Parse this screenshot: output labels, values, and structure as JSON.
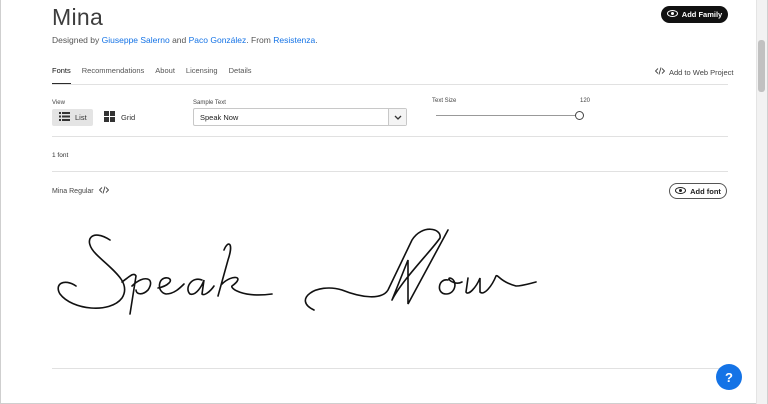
{
  "font": {
    "title": "Mina",
    "designed_prefix": "Designed by",
    "designer1": "Giuseppe Salerno",
    "and": "and",
    "designer2": "Paco González",
    "from": ". From",
    "foundry": "Resistenza",
    "period": "."
  },
  "header": {
    "add_family_label": "Add Family",
    "add_web_label": "Add to Web Project"
  },
  "tabs": [
    {
      "label": "Fonts",
      "active": true
    },
    {
      "label": "Recommendations",
      "active": false
    },
    {
      "label": "About",
      "active": false
    },
    {
      "label": "Licensing",
      "active": false
    },
    {
      "label": "Details",
      "active": false
    }
  ],
  "controls": {
    "view_label": "View",
    "list_label": "List",
    "grid_label": "Grid",
    "sample_label": "Sample Text",
    "sample_value": "Speak Now",
    "size_label": "Text Size",
    "size_value": "120"
  },
  "results": {
    "count": "1 font"
  },
  "style_card": {
    "name": "Mina Regular",
    "add_font_label": "Add font",
    "preview_text": "Speak Now"
  },
  "help": {
    "label": "?"
  },
  "colors": {
    "accent": "#1473e6",
    "dark": "#111111"
  },
  "icons": [
    "eye-icon",
    "code-icon",
    "list-icon",
    "grid-icon",
    "chevron-down-icon",
    "help-icon"
  ]
}
